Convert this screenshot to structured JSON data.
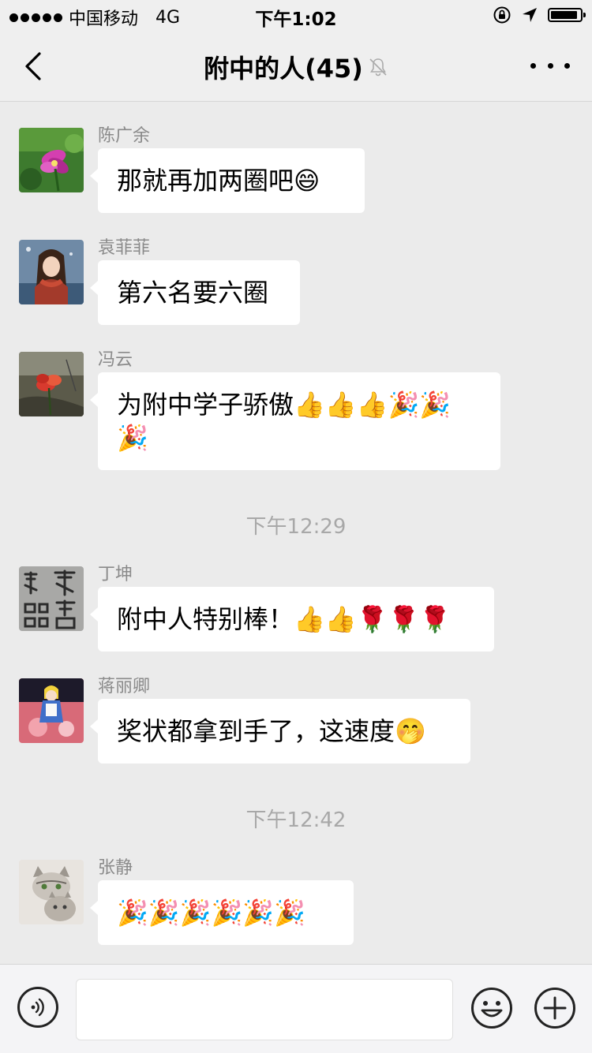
{
  "status_bar": {
    "carrier": "中国移动",
    "network": "4G",
    "time": "下午1:02",
    "battery_level": 0.92
  },
  "nav": {
    "title": "附中的人(45)",
    "muted": true
  },
  "messages": [
    {
      "sender": "陈广余",
      "text": "那就再加两圈吧😄",
      "avatar": "pink-flower-avatar"
    },
    {
      "sender": "袁菲菲",
      "text": "第六名要六圈",
      "avatar": "illustrated-girl-avatar"
    },
    {
      "sender": "冯云",
      "text": "为附中学子骄傲👍👍👍🎉🎉🎉",
      "avatar": "red-flower-avatar"
    },
    {
      "sender": "丁坤",
      "text": "附中人特别棒！👍👍🌹🌹🌹",
      "avatar": "calligraphy-avatar"
    },
    {
      "sender": "蒋丽卿",
      "text": "奖状都拿到手了，这速度🤭",
      "avatar": "doll-avatar"
    },
    {
      "sender": "张静",
      "text": "🎉🎉🎉🎉🎉🎉",
      "avatar": "cat-avatar"
    }
  ],
  "timestamps": [
    "下午12:29",
    "下午12:42"
  ],
  "input_bar": {
    "voice_icon": "voice-icon",
    "emoji_icon": "emoji-icon",
    "plus_icon": "plus-icon"
  }
}
